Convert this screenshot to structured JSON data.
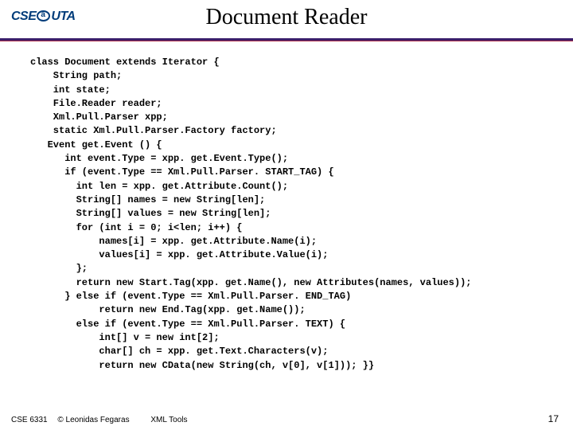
{
  "header": {
    "logo_left": "CSE",
    "logo_right": "UTA",
    "title": "Document Reader"
  },
  "code": {
    "l0": "class Document extends Iterator {",
    "l1": "    String path;",
    "l2": "    int state;",
    "l3": "    File.Reader reader;",
    "l4": "    Xml.Pull.Parser xpp;",
    "l5": "    static Xml.Pull.Parser.Factory factory;",
    "l6": "   Event get.Event () {",
    "l7": "      int event.Type = xpp. get.Event.Type();",
    "l8": "      if (event.Type == Xml.Pull.Parser. START_TAG) {",
    "l9": "        int len = xpp. get.Attribute.Count();",
    "l10": "        String[] names = new String[len];",
    "l11": "        String[] values = new String[len];",
    "l12": "        for (int i = 0; i<len; i++) {",
    "l13": "            names[i] = xpp. get.Attribute.Name(i);",
    "l14": "            values[i] = xpp. get.Attribute.Value(i);",
    "l15": "        };",
    "l16": "        return new Start.Tag(xpp. get.Name(), new Attributes(names, values));",
    "l17": "      } else if (event.Type == Xml.Pull.Parser. END_TAG)",
    "l18": "            return new End.Tag(xpp. get.Name());",
    "l19": "        else if (event.Type == Xml.Pull.Parser. TEXT) {",
    "l20": "            int[] v = new int[2];",
    "l21": "            char[] ch = xpp. get.Text.Characters(v);",
    "l22": "            return new CData(new String(ch, v[0], v[1])); }}"
  },
  "footer": {
    "course": "CSE 6331",
    "copyright": "© Leonidas Fegaras",
    "middle": "XML Tools",
    "page": "17"
  }
}
